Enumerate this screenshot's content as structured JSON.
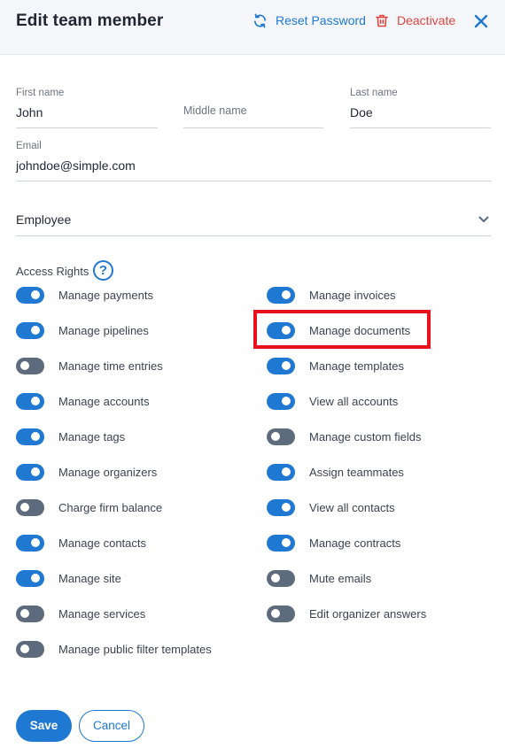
{
  "header": {
    "title": "Edit team member",
    "reset_password": "Reset Password",
    "deactivate": "Deactivate"
  },
  "form": {
    "first_name": {
      "label": "First name",
      "value": "John"
    },
    "middle_name": {
      "label": "Middle name",
      "value": ""
    },
    "last_name": {
      "label": "Last name",
      "value": "Doe"
    },
    "email": {
      "label": "Email",
      "value": "johndoe@simple.com"
    },
    "role": {
      "value": "Employee"
    }
  },
  "access_rights": {
    "label": "Access Rights",
    "help": "?",
    "left": [
      {
        "label": "Manage payments",
        "enabled": true
      },
      {
        "label": "Manage pipelines",
        "enabled": true
      },
      {
        "label": "Manage time entries",
        "enabled": false
      },
      {
        "label": "Manage accounts",
        "enabled": true
      },
      {
        "label": "Manage tags",
        "enabled": true
      },
      {
        "label": "Manage organizers",
        "enabled": true
      },
      {
        "label": "Charge firm balance",
        "enabled": false
      },
      {
        "label": "Manage contacts",
        "enabled": true
      },
      {
        "label": "Manage site",
        "enabled": true
      },
      {
        "label": "Manage services",
        "enabled": false
      },
      {
        "label": "Manage public filter templates",
        "enabled": false
      }
    ],
    "right": [
      {
        "label": "Manage invoices",
        "enabled": true
      },
      {
        "label": "Manage documents",
        "enabled": true
      },
      {
        "label": "Manage templates",
        "enabled": true
      },
      {
        "label": "View all accounts",
        "enabled": true
      },
      {
        "label": "Manage custom fields",
        "enabled": false
      },
      {
        "label": "Assign teammates",
        "enabled": true
      },
      {
        "label": "View all contacts",
        "enabled": true
      },
      {
        "label": "Manage contracts",
        "enabled": true
      },
      {
        "label": "Mute emails",
        "enabled": false
      },
      {
        "label": "Edit organizer answers",
        "enabled": false
      }
    ]
  },
  "footer": {
    "save": "Save",
    "cancel": "Cancel"
  },
  "colors": {
    "accent": "#1f78d1",
    "danger": "#e0463f",
    "toggle_off": "#5d6b7c",
    "highlight": "#e8121e"
  }
}
